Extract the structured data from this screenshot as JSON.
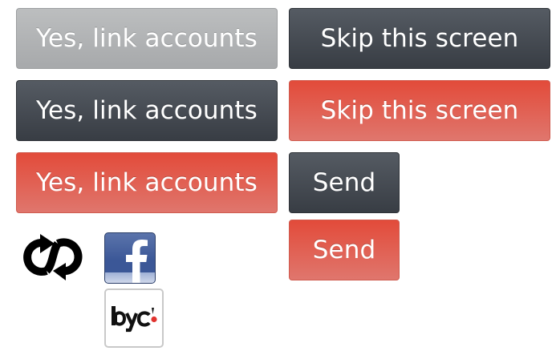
{
  "buttons": {
    "link_disabled": "Yes, link accounts",
    "link_dark": "Yes, link accounts",
    "link_red": "Yes, link accounts",
    "skip_dark": "Skip this screen",
    "skip_red": "Skip this screen",
    "send_dark": "Send",
    "send_red": "Send"
  },
  "icons": {
    "sync": "sync-icon",
    "facebook": "facebook-icon",
    "byc": "byc-logo-icon"
  },
  "logo_text": "byc",
  "colors": {
    "disabled_gray": "#b2b4b6",
    "dark": "#43484f",
    "red": "#e0574a",
    "facebook_blue": "#3b5797",
    "byc_dot": "#e0332f"
  }
}
